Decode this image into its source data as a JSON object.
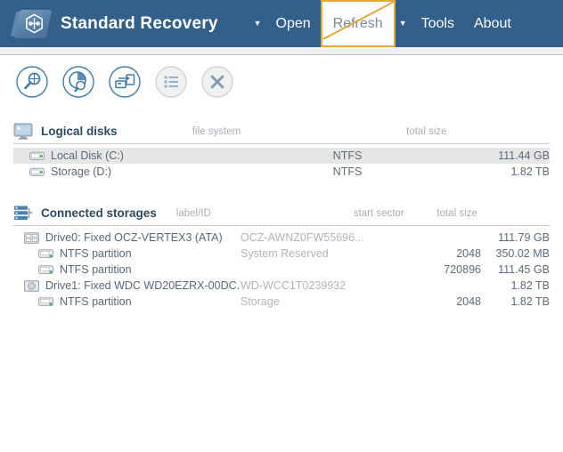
{
  "app": {
    "title": "Standard Recovery",
    "logo_icon": "folder-hexagon-logo"
  },
  "menu": {
    "open_caret": "▼",
    "open_label": "Open",
    "refresh_label": "Refresh",
    "refresh_caret": "▼",
    "tools_label": "Tools",
    "about_label": "About",
    "highlight_color": "#e2a93e",
    "header_color": "#33608a"
  },
  "toolbar": {
    "buttons": [
      {
        "name": "scan-icon",
        "label": "Scan",
        "enabled": true
      },
      {
        "name": "disk-analyze-icon",
        "label": "Disk analysis",
        "enabled": true
      },
      {
        "name": "disk-copy-icon",
        "label": "Disk copy",
        "enabled": true
      },
      {
        "name": "list-view-icon",
        "label": "List view",
        "enabled": false
      },
      {
        "name": "close-icon",
        "label": "Close",
        "enabled": false
      }
    ]
  },
  "logical_disks": {
    "icon": "monitor-icon",
    "title": "Logical disks",
    "columns": {
      "name": "",
      "file_system": "file system",
      "total_size": "total size"
    },
    "rows": [
      {
        "icon": "drive-icon",
        "name": "Local Disk (C:)",
        "file_system": "NTFS",
        "total_size": "111.44 GB",
        "selected": true
      },
      {
        "icon": "drive-icon",
        "name": "Storage (D:)",
        "file_system": "NTFS",
        "total_size": "1.82 TB",
        "selected": false
      }
    ]
  },
  "connected_storages": {
    "icon": "stacked-disks-icon",
    "title": "Connected storages",
    "columns": {
      "name": "",
      "label_id": "label/ID",
      "start_sector": "start sector",
      "total_size": "total size"
    },
    "rows": [
      {
        "icon": "ssd-grid-icon",
        "level": 1,
        "name": "Drive0: Fixed OCZ-VERTEX3 (ATA)",
        "label_id": "OCZ-AWNZ0FW55696...",
        "start_sector": "",
        "total_size": "111.79 GB"
      },
      {
        "icon": "partition-icon",
        "level": 2,
        "name": "NTFS partition",
        "label_id": "System Reserved",
        "start_sector": "2048",
        "total_size": "350.02 MB"
      },
      {
        "icon": "partition-icon",
        "level": 2,
        "name": "NTFS partition",
        "label_id": "",
        "start_sector": "720896",
        "total_size": "111.45 GB"
      },
      {
        "icon": "hdd-platter-icon",
        "level": 1,
        "name": "Drive1: Fixed WDC WD20EZRX-00DC...",
        "label_id": "WD-WCC1T0239932",
        "start_sector": "",
        "total_size": "1.82 TB"
      },
      {
        "icon": "partition-icon",
        "level": 2,
        "name": "NTFS partition",
        "label_id": "Storage",
        "start_sector": "2048",
        "total_size": "1.82 TB"
      }
    ]
  }
}
